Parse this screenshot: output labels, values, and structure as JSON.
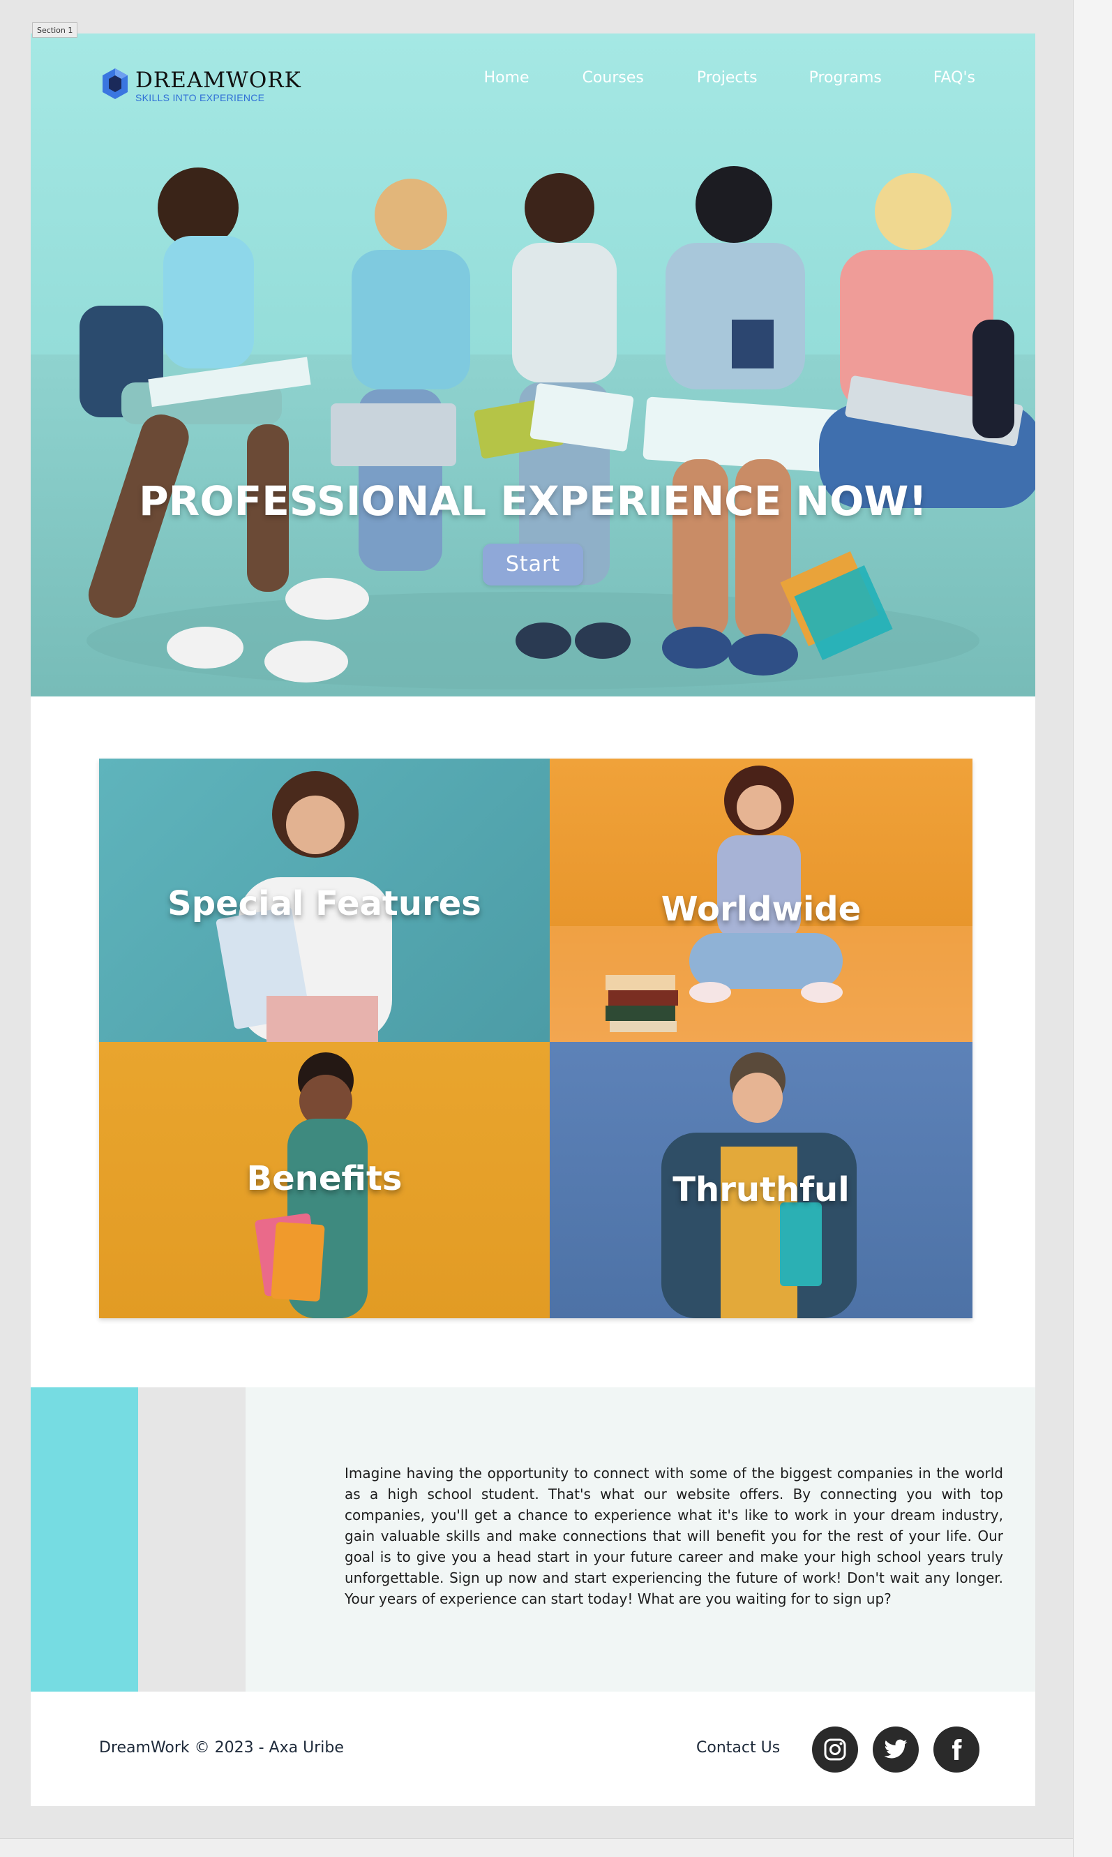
{
  "canvas": {
    "section_label": "Section 1"
  },
  "brand": {
    "name": "DREAMWORK",
    "tagline": "SKILLS INTO EXPERIENCE",
    "accent_color": "#2f6fd6"
  },
  "nav": {
    "items": [
      {
        "label": "Home"
      },
      {
        "label": "Courses"
      },
      {
        "label": "Projects"
      },
      {
        "label": "Programs"
      },
      {
        "label": "FAQ's"
      }
    ]
  },
  "hero": {
    "title": "PROFESSIONAL EXPERIENCE NOW!",
    "button_label": "Start",
    "overlay_color": "#8fdcd8"
  },
  "cards": [
    {
      "title": "Special Features",
      "color": "#4c9ca6"
    },
    {
      "title": "Worldwide",
      "color": "#e8962c"
    },
    {
      "title": "Benefits",
      "color": "#e29b24"
    },
    {
      "title": "Thruthful",
      "color": "#4d72a6"
    }
  ],
  "about": {
    "text": "Imagine having the opportunity to connect with some of the biggest companies in the world as a high school student. That's what our website offers. By connecting you with top companies, you'll get a chance to experience what it's like to work in your dream industry, gain valuable skills and make connections that will benefit you for the rest of your life. Our goal is to give you a head start in your future career and make your high school years truly unforgettable. Sign up now and start experiencing the future of work! Don't wait any longer. Your years of experience can start today! What are you waiting for to sign up?",
    "accent_color": "#76dce2"
  },
  "footer": {
    "copyright": "DreamWork © 2023 - Axa Uribe",
    "contact_label": "Contact Us",
    "social": [
      {
        "icon": "instagram-icon"
      },
      {
        "icon": "twitter-icon"
      },
      {
        "icon": "facebook-icon"
      }
    ]
  }
}
